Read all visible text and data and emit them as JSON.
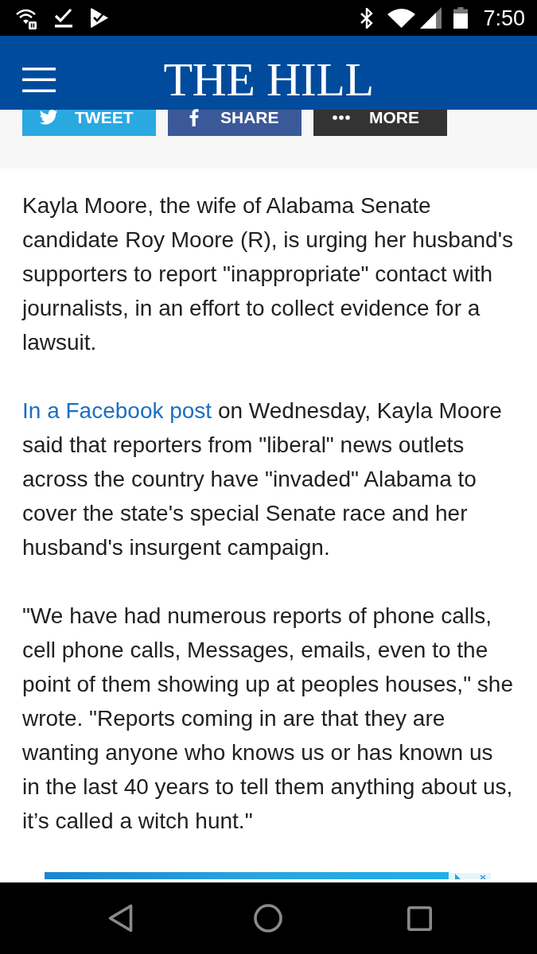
{
  "status_bar": {
    "time": "7:50"
  },
  "header": {
    "logo": "THE HILL"
  },
  "share_buttons": [
    {
      "kind": "tweet",
      "label": "TWEET",
      "color": "#2aa9e0"
    },
    {
      "kind": "share",
      "label": "SHARE",
      "color": "#3b5998"
    },
    {
      "kind": "more",
      "label": "MORE",
      "color": "#333333"
    }
  ],
  "article": {
    "paragraphs": [
      {
        "text": "Kayla Moore, the wife of Alabama Senate candidate Roy Moore (R), is urging her husband's supporters to report \"inappropriate\" contact with journalists, in an effort to collect evidence for a lawsuit."
      },
      {
        "link": "In a Facebook post",
        "text": "on Wednesday, Kayla Moore said that reporters from \"liberal\" news outlets across the country have \"invaded\" Alabama to cover the state's special Senate race and her husband's insurgent campaign."
      },
      {
        "text": "\"We have had numerous reports of phone calls, cell phone calls, Messages, emails, even to the point of them showing up at peoples houses,\" she wrote. \"Reports coming in are that they are wanting anyone who knows us or has known us in the last 40 years to tell them anything about us, it’s called a witch hunt.\""
      }
    ]
  }
}
